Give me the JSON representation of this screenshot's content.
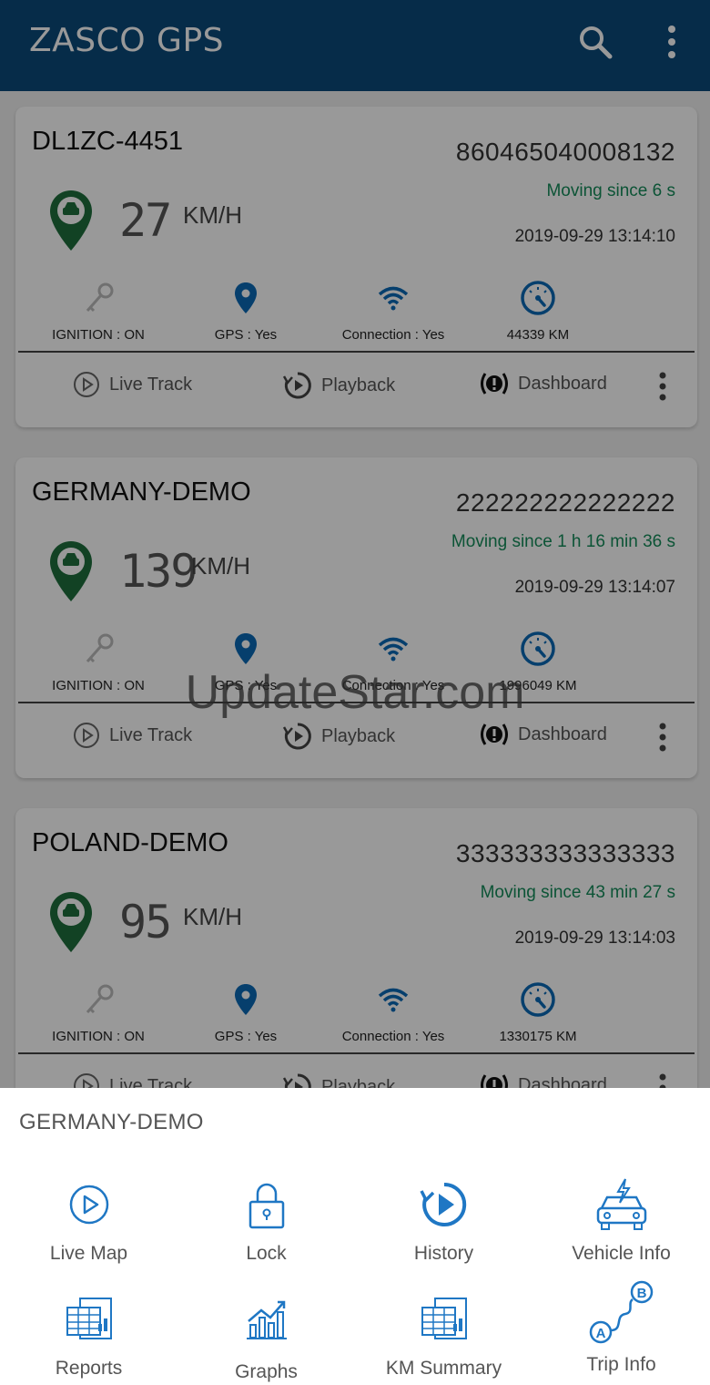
{
  "app": {
    "title": "ZASCO GPS",
    "icons": {
      "search": "search-icon",
      "more": "more-vert-icon"
    }
  },
  "colors": {
    "appbar": "#0a4a7a",
    "accent_blue": "#0a69b6",
    "moving_green": "#158c5a",
    "pin_green": "#1f6e3d"
  },
  "vehicles": [
    {
      "name": "DL1ZC-4451",
      "imei": "860465040008132",
      "status": "Moving since 6 s",
      "datetime": "2019-09-29 13:14:10",
      "speed": "27",
      "unit": "KM/H",
      "ignition": "IGNITION : ON",
      "gps": "GPS : Yes",
      "connection": "Connection : Yes",
      "odometer": "44339 KM",
      "actions": {
        "live_track": "Live Track",
        "playback": "Playback",
        "dashboard": "Dashboard"
      }
    },
    {
      "name": "GERMANY-DEMO",
      "imei": "222222222222222",
      "status": "Moving since 1 h 16 min 36 s",
      "datetime": "2019-09-29 13:14:07",
      "speed": "139",
      "unit": "KM/H",
      "ignition": "IGNITION : ON",
      "gps": "GPS : Yes",
      "connection": "Connection : Yes",
      "odometer": "1996049 KM",
      "actions": {
        "live_track": "Live Track",
        "playback": "Playback",
        "dashboard": "Dashboard"
      }
    },
    {
      "name": "POLAND-DEMO",
      "imei": "333333333333333",
      "status": "Moving since 43 min 27 s",
      "datetime": "2019-09-29 13:14:03",
      "speed": "95",
      "unit": "KM/H",
      "ignition": "IGNITION : ON",
      "gps": "GPS : Yes",
      "connection": "Connection : Yes",
      "odometer": "1330175 KM",
      "actions": {
        "live_track": "Live Track",
        "playback": "Playback",
        "dashboard": "Dashboard"
      }
    }
  ],
  "watermark": "UpdateStar.com",
  "sheet": {
    "title": "GERMANY-DEMO",
    "options": [
      {
        "label": "Live Map",
        "icon": "play-circle-icon"
      },
      {
        "label": "Lock",
        "icon": "lock-icon"
      },
      {
        "label": "History",
        "icon": "history-icon"
      },
      {
        "label": "Vehicle Info",
        "icon": "car-info-icon"
      },
      {
        "label": "Reports",
        "icon": "reports-icon"
      },
      {
        "label": "Graphs",
        "icon": "graphs-icon"
      },
      {
        "label": "KM Summary",
        "icon": "km-summary-icon"
      },
      {
        "label": "Trip Info",
        "icon": "trip-info-icon"
      }
    ]
  }
}
